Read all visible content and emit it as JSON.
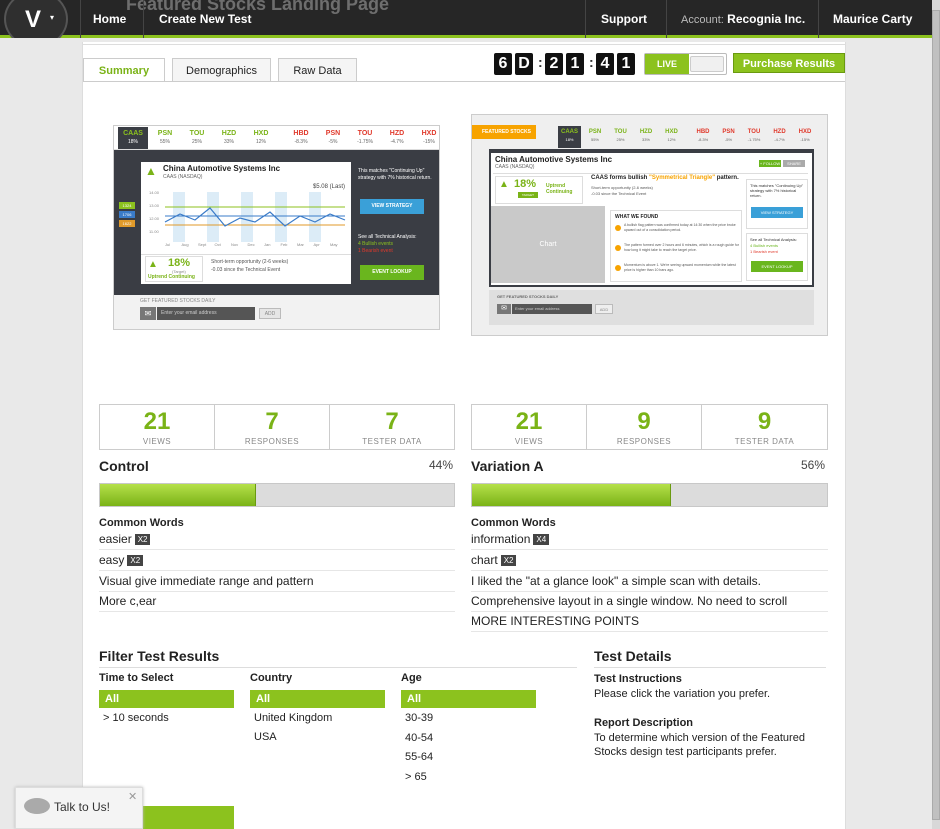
{
  "nav": {
    "ghost_title": "Featured Stocks Landing Page",
    "home": "Home",
    "create": "Create New Test",
    "support": "Support",
    "account_label": "Account:",
    "account_name": "Recognia Inc.",
    "user": "Maurice Carty"
  },
  "logo": {
    "letter": "V",
    "caret": "▾"
  },
  "tabs": {
    "summary": "Summary",
    "demographics": "Demographics",
    "raw": "Raw Data"
  },
  "timer": {
    "d1": "6",
    "d2": "D",
    "h1": "2",
    "h2": "1",
    "m1": "4",
    "m2": "1",
    "colon": ":"
  },
  "live": "LIVE",
  "purchase": "Purchase Results",
  "preview_a": {
    "tickers": [
      {
        "s": "CAAS",
        "v": "18%"
      },
      {
        "s": "PSN",
        "v": "55%"
      },
      {
        "s": "TOU",
        "v": "25%"
      },
      {
        "s": "HZD",
        "v": "33%"
      },
      {
        "s": "HXD",
        "v": "12%"
      },
      {
        "s": "HBD",
        "v": "-8.3%"
      },
      {
        "s": "PSN",
        "v": "-5%"
      },
      {
        "s": "TOU",
        "v": "-1.75%"
      },
      {
        "s": "HZD",
        "v": "-4.7%"
      },
      {
        "s": "HXD",
        "v": "-15%"
      }
    ],
    "company": "China Automotive Systems Inc",
    "exchange": "CAAS (NASDAQ)",
    "price": "$5.08 (Last)",
    "pct": "18%",
    "target": "(Target)",
    "trend": "Uptrend Continuing",
    "short_term": "Short-term opportunity (2-6 weeks)",
    "since": "-0.03 since the Technical Event",
    "matches": "This matches \"Continuing Up\" strategy with 7% historical return.",
    "view_strategy": "VIEW STRATEGY",
    "see_all": "See all Technical Analysis:",
    "bullish": "4 Bullish events",
    "bearish": "1 Bearish event",
    "event_lookup": "EVENT LOOKUP",
    "get_featured": "GET FEATURED STOCKS DAILY",
    "email_placeholder": "Enter your email address",
    "add": "ADD",
    "ylabels": [
      "14.00",
      "13.00",
      "12.00",
      "11.00"
    ],
    "xlabels": [
      "Jul",
      "Aug",
      "Sept",
      "Oct",
      "Nov",
      "Dec",
      "Jan",
      "Feb",
      "Mar",
      "Apr",
      "May"
    ],
    "markers": [
      "1324",
      "1706",
      "1622"
    ]
  },
  "preview_b": {
    "ribbon": "FEATURED STOCKS",
    "tickers": [
      {
        "s": "CAAS",
        "v": "18%"
      },
      {
        "s": "PSN",
        "v": "55%"
      },
      {
        "s": "TOU",
        "v": "25%"
      },
      {
        "s": "HZD",
        "v": "33%"
      },
      {
        "s": "HXD",
        "v": "12%"
      },
      {
        "s": "HBD",
        "v": "-8.3%"
      },
      {
        "s": "PSN",
        "v": "-5%"
      },
      {
        "s": "TOU",
        "v": "-1.75%"
      },
      {
        "s": "HZD",
        "v": "-4.7%"
      },
      {
        "s": "HXD",
        "v": "-15%"
      }
    ],
    "company": "China Automotive Systems Inc",
    "exchange": "CAAS (NASDAQ)",
    "follow": "+ FOLLOW",
    "share": "SHARE",
    "pct": "18%",
    "target": "TARGET",
    "trend": "Uptrend Continuing",
    "forms": "CAAS forms bullish",
    "pattern": "\"Symmetrical Triangle\"",
    "pattern_end": "pattern.",
    "short_term": "Short-term opportunity (2-6 weeks)",
    "since": "-0.03 since the Technical Event",
    "chart": "Chart",
    "what_we_found": "WHAT WE FOUND",
    "found1": "A bullish flag pattern was confirmed today at 14:30 when the price broke upward out of a consolidation period.",
    "found2": "The pattern formed over 2 hours and 6 minutes, which is a rough guide for how long it might take to reach the target price.",
    "found3": "Momentum is above 1. We're seeing upward momentum while the latest price is higher than 10 bars ago.",
    "matches": "This matches \"Continuing Up\" strategy with 7% historical return.",
    "view_strategy": "VIEW STRATEGY",
    "see_all": "See all Technical Analysis:",
    "bullish": "4 Bullish events",
    "bearish": "1 Bearish event",
    "event_lookup": "EVENT LOOKUP",
    "get_featured": "GET FEATURED STOCKS DAILY",
    "email_placeholder": "Enter your email address",
    "add": "ADD"
  },
  "control": {
    "views": "21",
    "views_label": "VIEWS",
    "responses": "7",
    "responses_label": "RESPONSES",
    "tester": "7",
    "tester_label": "TESTER DATA",
    "name": "Control",
    "percent": "44%",
    "share": 0.44,
    "common_words": "Common Words",
    "rows": [
      {
        "text": "easier",
        "badge": "X2"
      },
      {
        "text": "easy",
        "badge": "X2"
      },
      {
        "text": "Visual give immediate range and pattern",
        "badge": ""
      },
      {
        "text": "More c,ear",
        "badge": ""
      }
    ]
  },
  "variation": {
    "views": "21",
    "views_label": "VIEWS",
    "responses": "9",
    "responses_label": "RESPONSES",
    "tester": "9",
    "tester_label": "TESTER DATA",
    "name": "Variation A",
    "percent": "56%",
    "share": 0.56,
    "common_words": "Common Words",
    "rows": [
      {
        "text": "information",
        "badge": "X4"
      },
      {
        "text": "chart",
        "badge": "X2"
      },
      {
        "text": "I liked the \"at a glance look\" a simple scan with details.",
        "badge": ""
      },
      {
        "text": "Comprehensive layout in a single window. No need to scroll",
        "badge": ""
      },
      {
        "text": "MORE INTERESTING POINTS",
        "badge": ""
      }
    ]
  },
  "filter": {
    "title": "Filter Test Results",
    "time_label": "Time to Select",
    "time_all": "All",
    "time_items": [
      "> 10 seconds"
    ],
    "country_label": "Country",
    "country_all": "All",
    "country_items": [
      "United Kingdom",
      "USA"
    ],
    "age_label": "Age",
    "age_all": "All",
    "age_items": [
      "30-39",
      "40-54",
      "55-64",
      "> 65"
    ]
  },
  "details": {
    "title": "Test Details",
    "instr_head": "Test Instructions",
    "instr_text": "Please click the variation you prefer.",
    "report_head": "Report Description",
    "report_text": "To determine which version of the Featured Stocks design test participants prefer."
  },
  "talk": {
    "label": "Talk to Us!",
    "close": "✕"
  }
}
